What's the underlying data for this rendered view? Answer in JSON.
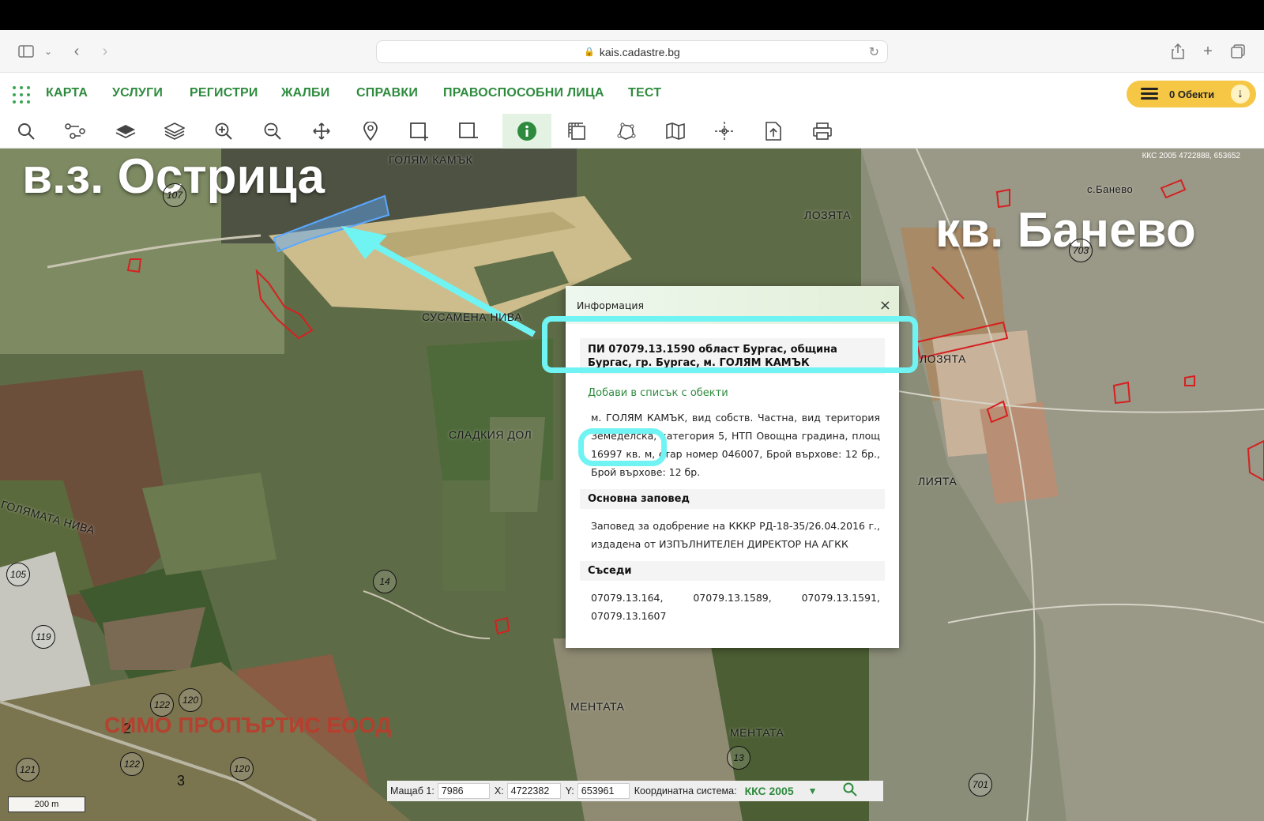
{
  "browser": {
    "url": "kais.cadastre.bg"
  },
  "nav": {
    "items": [
      "КАРТА",
      "УСЛУГИ",
      "РЕГИСТРИ",
      "ЖАЛБИ",
      "СПРАВКИ",
      "ПРАВОСПОСОБНИ ЛИЦА",
      "ТЕСТ"
    ],
    "objects_label": "0 Обекти"
  },
  "toolbar": {
    "tools": [
      "search-icon",
      "route-icon",
      "layer-icon",
      "layers-icon",
      "zoom-in-icon",
      "zoom-out-icon",
      "pan-icon",
      "marker-icon",
      "select-rect-add-icon",
      "select-rect-remove-icon",
      "info-icon",
      "measure-icon",
      "polygon-icon",
      "map-icon",
      "coordinate-icon",
      "export-icon",
      "print-icon"
    ],
    "active": "info-icon"
  },
  "map": {
    "coord_readout": "ККС 2005 4722888, 653652",
    "title_left": "в.з. Острица",
    "title_right": "кв. Банево",
    "labels": {
      "golyam_kamak": "ГОЛЯМ КАМЪК",
      "lozyata_1": "ЛОЗЯТА",
      "lozyata_2": "ЛОЗЯТА",
      "s_banevo": "с.Банево",
      "susamena_niva": "СУСАМЕНА НИВА",
      "sladkiya_dol": "СЛАДКИЯ ДОЛ",
      "golyamata_niva": "ГОЛЯМАТА НИВА",
      "mentata_1": "МЕНТАТА",
      "mentata_2": "МЕНТАТА",
      "liyata": "ЛИЯТА"
    },
    "watermark": "СИМО ПРОПЪРТИС ЕООД",
    "road_numbers": [
      "107",
      "703",
      "105",
      "119",
      "14",
      "122",
      "120",
      "121",
      "122",
      "120",
      "13",
      "701"
    ],
    "small_numbers": [
      "2",
      "3"
    ],
    "scale_label": "200 m"
  },
  "popup": {
    "header": "Информация",
    "close": "×",
    "pi_title": "ПИ 07079.13.1590 област Бургас, община Бургас, гр. Бургас, м. ГОЛЯМ КАМЪК",
    "add_link": "Добави в списък с обекти",
    "description": "м. ГОЛЯМ КАМЪК, вид собств. Частна, вид територия Земеделска, категория 5, НТП Овощна градина, площ 16997 кв. м, стар номер 046007, Брой върхове: 12 бр., Брой върхове: 12 бр.",
    "section_order": "Основна заповед",
    "order_text": "Заповед за одобрение на КККР РД-18-35/26.04.2016 г., издадена от ИЗПЪЛНИТЕЛЕН ДИРЕКТОР НА АГКК",
    "section_neighbors": "Съседи",
    "neighbors_text": "07079.13.164, 07079.13.1589, 07079.13.1591, 07079.13.1607"
  },
  "status": {
    "scale_label": "Мащаб 1:",
    "scale_value": "7986",
    "x_label": "X:",
    "x_value": "4722382",
    "y_label": "Y:",
    "y_value": "653961",
    "crs_label": "Координатна система:",
    "crs_value": "ККС 2005"
  },
  "colors": {
    "brand_green": "#2e8b3e",
    "accent_yellow": "#f5c744",
    "highlight_cyan": "#6ff3f3",
    "parcel_blue": "#5aa8ff",
    "parcel_red": "#d62020"
  }
}
